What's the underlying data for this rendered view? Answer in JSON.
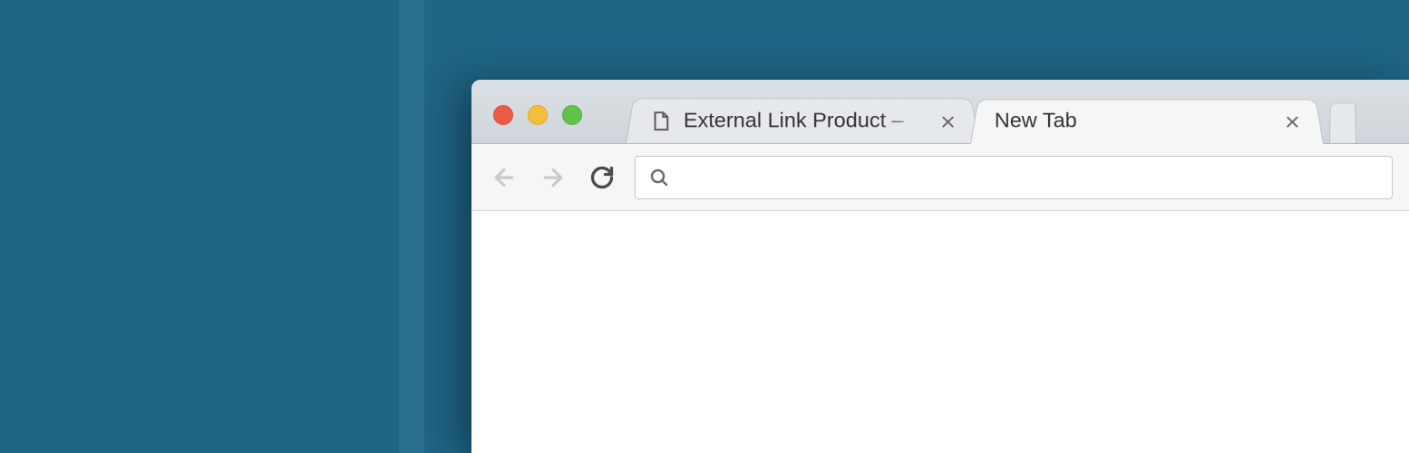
{
  "tabs": [
    {
      "title": "External Link Product – ",
      "active": false,
      "favicon": "file-icon"
    },
    {
      "title": "New Tab",
      "active": true,
      "favicon": null
    }
  ],
  "omnibox": {
    "value": "",
    "placeholder": ""
  },
  "colors": {
    "background": "#1f6586",
    "traffic_close": "#eb5b47",
    "traffic_min": "#f6bd3b",
    "traffic_max": "#62c34b"
  }
}
